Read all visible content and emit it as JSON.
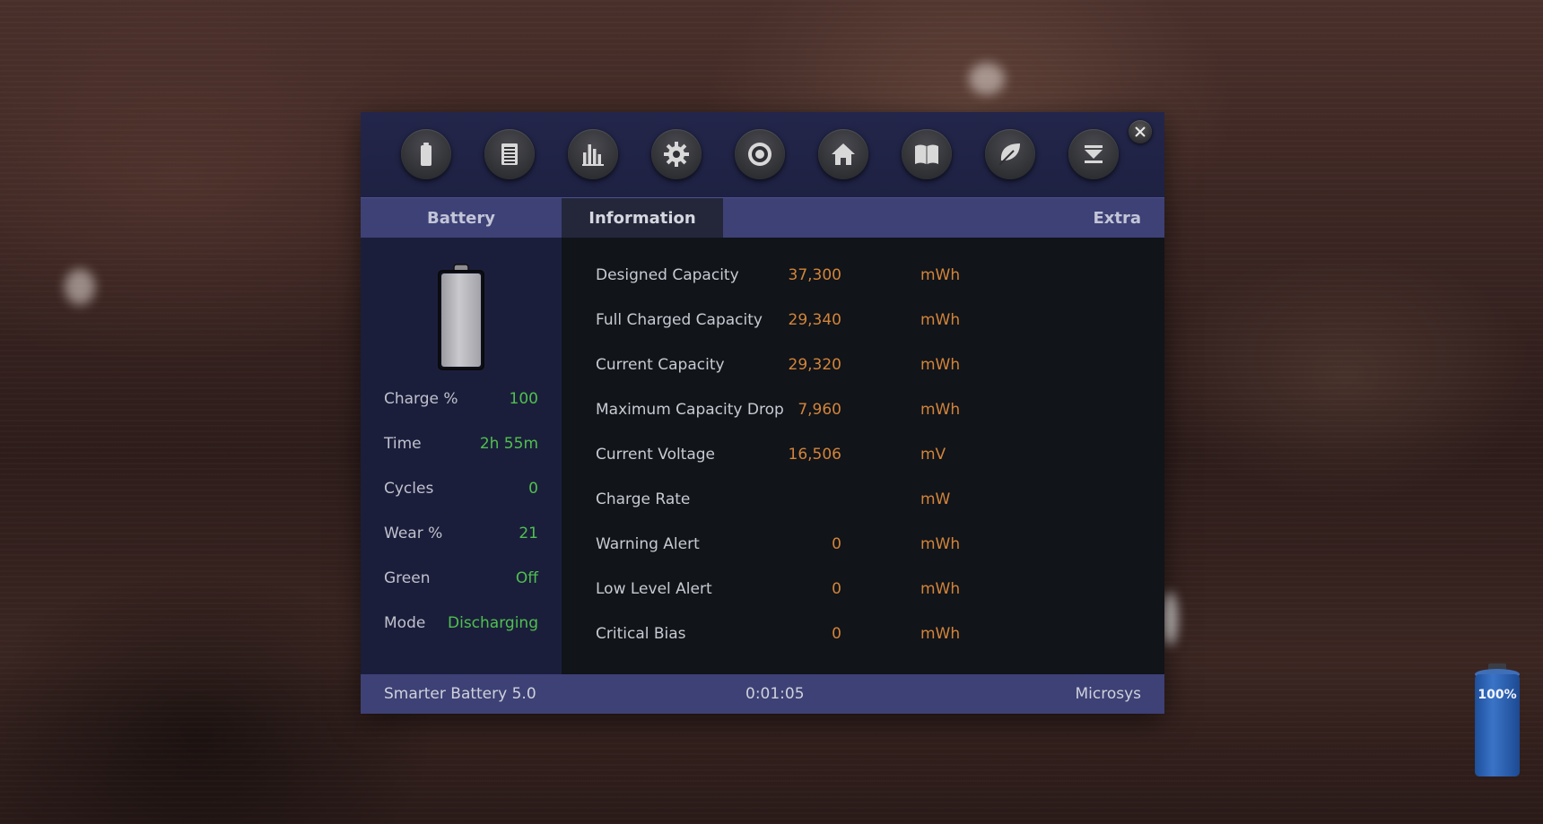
{
  "toolbar": {
    "buttons": [
      {
        "icon": "battery-icon"
      },
      {
        "icon": "list-icon"
      },
      {
        "icon": "bar-chart-icon"
      },
      {
        "icon": "gear-icon"
      },
      {
        "icon": "target-icon"
      },
      {
        "icon": "home-icon"
      },
      {
        "icon": "book-icon"
      },
      {
        "icon": "leaf-icon"
      },
      {
        "icon": "download-icon"
      }
    ],
    "close_icon": "close-icon"
  },
  "tabs": {
    "battery": "Battery",
    "information": "Information",
    "extra": "Extra"
  },
  "battery_stats": [
    {
      "label": "Charge %",
      "value": "100"
    },
    {
      "label": "Time",
      "value": "2h 55m"
    },
    {
      "label": "Cycles",
      "value": "0"
    },
    {
      "label": "Wear %",
      "value": "21"
    },
    {
      "label": "Green",
      "value": "Off"
    },
    {
      "label": "Mode",
      "value": "Discharging"
    }
  ],
  "information": [
    {
      "label": "Designed Capacity",
      "value": "37,300",
      "unit": "mWh"
    },
    {
      "label": "Full Charged Capacity",
      "value": "29,340",
      "unit": "mWh"
    },
    {
      "label": "Current Capacity",
      "value": "29,320",
      "unit": "mWh"
    },
    {
      "label": "Maximum Capacity Drop",
      "value": "7,960",
      "unit": "mWh"
    },
    {
      "label": "Current Voltage",
      "value": "16,506",
      "unit": "mV"
    },
    {
      "label": "Charge Rate",
      "value": "",
      "unit": "mW"
    },
    {
      "label": "Warning Alert",
      "value": "0",
      "unit": "mWh"
    },
    {
      "label": "Low Level Alert",
      "value": "0",
      "unit": "mWh"
    },
    {
      "label": "Critical Bias",
      "value": "0",
      "unit": "mWh"
    }
  ],
  "statusbar": {
    "app_name": "Smarter Battery 5.0",
    "elapsed": "0:01:05",
    "vendor": "Microsys"
  },
  "tray": {
    "percent": "100%"
  },
  "colors": {
    "accent_green": "#4fc04f",
    "value_orange": "#d2843a",
    "tab_bar": "#3d4175",
    "toolbar": "#23264a"
  }
}
